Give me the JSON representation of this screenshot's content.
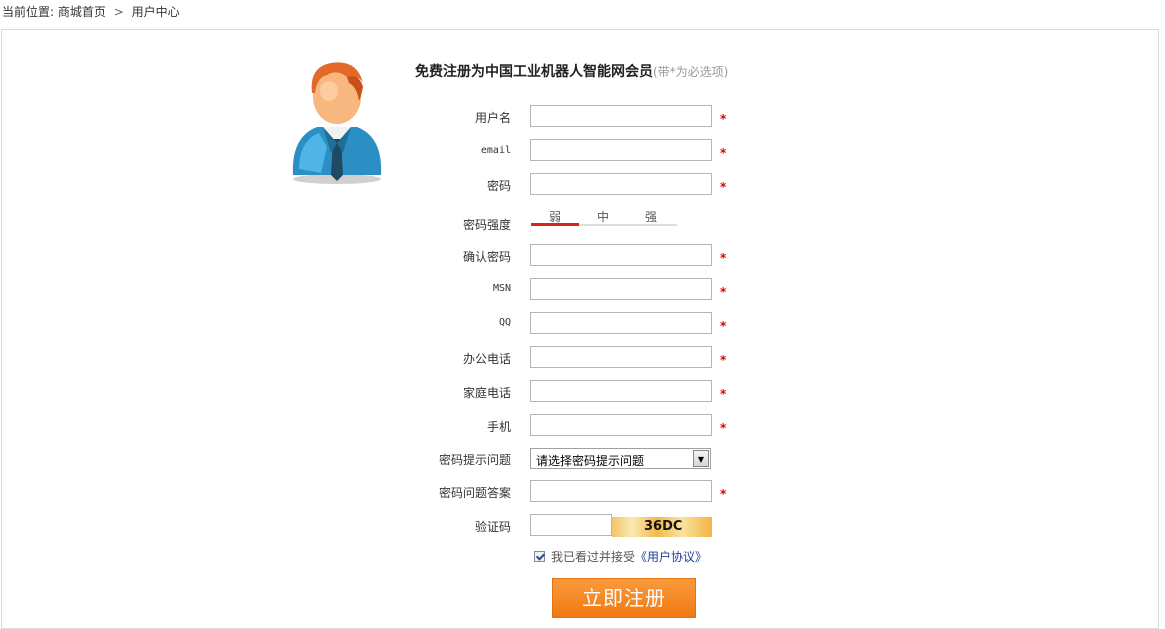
{
  "breadcrumb": {
    "prefix": "当前位置:",
    "home": "商城首页",
    "separator": ">",
    "current": "用户中心"
  },
  "register": {
    "title": "免费注册为中国工业机器人智能网会员",
    "hint": "(带*为必选项)",
    "required_mark": "*",
    "fields": {
      "username": "用户名",
      "email": "email",
      "password": "密码",
      "strength_label": "密码强度",
      "confirm_password": "确认密码",
      "msn": "MSN",
      "qq": "QQ",
      "office_phone": "办公电话",
      "home_phone": "家庭电话",
      "mobile": "手机",
      "question": "密码提示问题",
      "answer": "密码问题答案",
      "captcha": "验证码"
    },
    "strength": {
      "weak": "弱",
      "medium": "中",
      "strong": "强",
      "level": 0.33
    },
    "question_select": "请选择密码提示问题",
    "captcha_code": "36DC",
    "agree_prefix": "我已看过并接受",
    "agree_link": "《用户协议》",
    "submit": "立即注册"
  },
  "colors": {
    "required": "#d00",
    "submit": "#f07a12",
    "strength_bar": "#d9241c",
    "link": "#1d3e9b"
  }
}
